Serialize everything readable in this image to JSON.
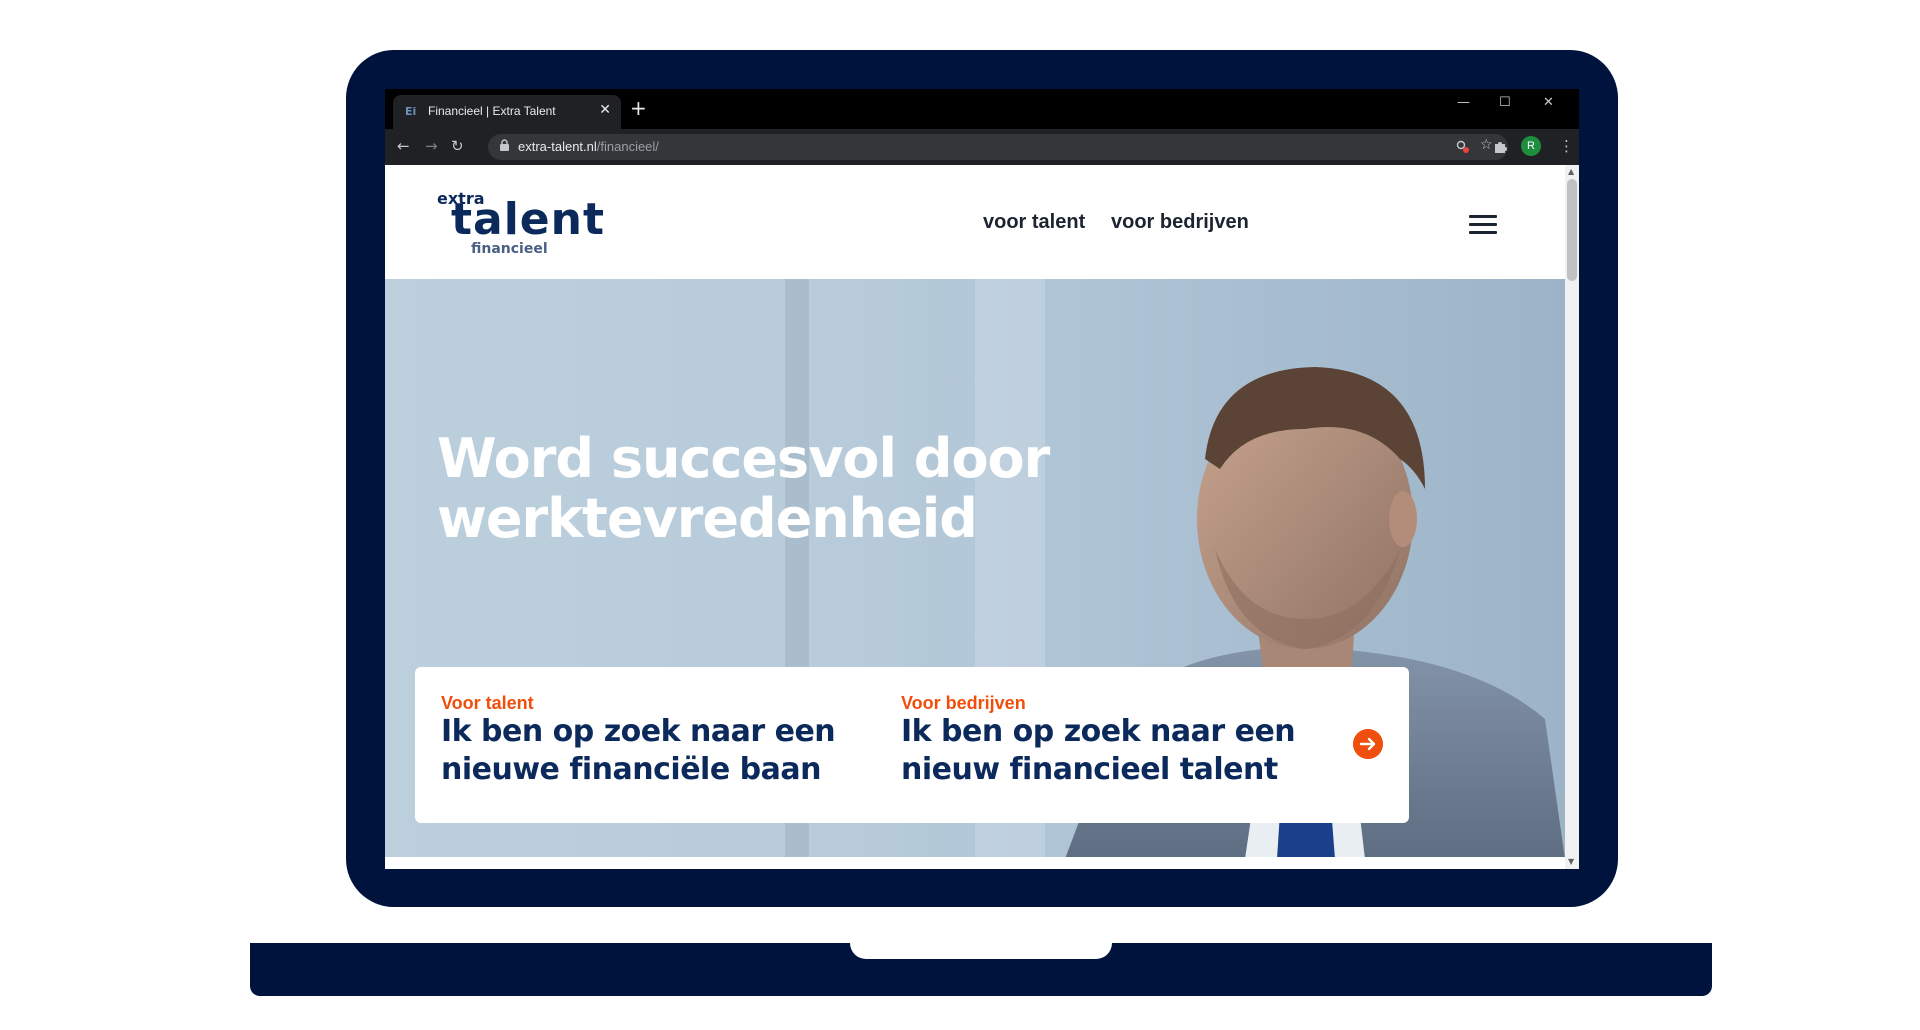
{
  "browser": {
    "tab_title": "Financieel | Extra Talent",
    "tab_favicon": "Ei",
    "tab_close": "✕",
    "new_tab": "+",
    "window_minimize": "—",
    "window_maximize": "☐",
    "window_close": "✕",
    "url_host": "extra-talent.nl",
    "url_path": "/financieel/",
    "profile_initial": "R"
  },
  "site": {
    "logo": {
      "extra": "extra",
      "talent": "talent",
      "financieel": "financieel"
    },
    "nav": [
      "voor talent",
      "voor bedrijven"
    ]
  },
  "hero": {
    "title_line1": "Word succesvol door",
    "title_line2": "werktevredenheid"
  },
  "cards": [
    {
      "kicker": "Voor talent",
      "line1": "Ik ben op zoek naar een",
      "line2": "nieuwe financiële baan"
    },
    {
      "kicker": "Voor bedrijven",
      "line1": "Ik ben op zoek naar een",
      "line2": "nieuw financieel talent"
    }
  ],
  "colors": {
    "frame": "#00133d",
    "brand_navy": "#0b2a5b",
    "accent_orange": "#f04e0c"
  }
}
